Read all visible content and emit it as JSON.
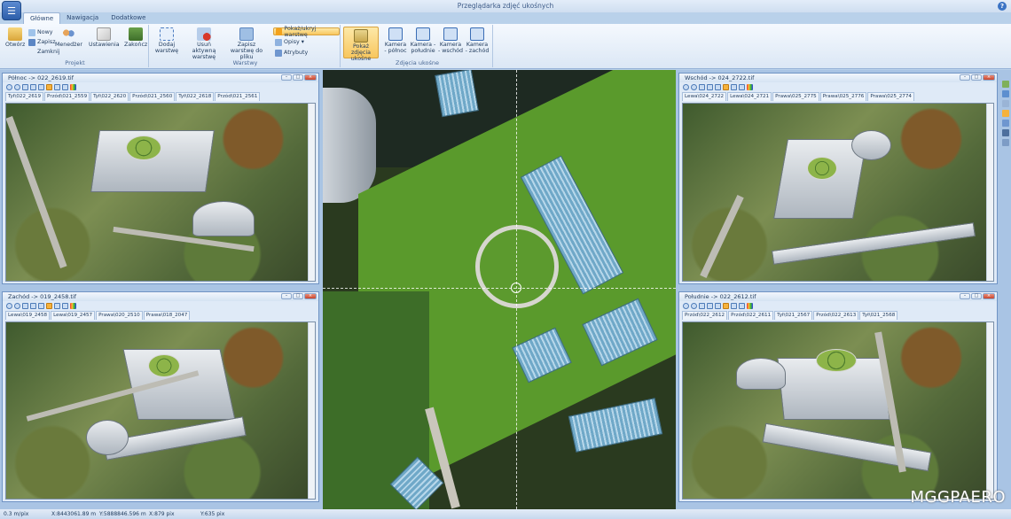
{
  "window": {
    "title": "Przeglądarka zdjęć ukośnych",
    "help": "?"
  },
  "tabs": [
    {
      "label": "Główne"
    },
    {
      "label": "Nawigacja"
    },
    {
      "label": "Dodatkowe"
    }
  ],
  "ribbon": {
    "projekt": {
      "label": "Projekt",
      "open": "Otwórz",
      "new": "Nowy",
      "save": "Zapisz",
      "close": "Zamknij",
      "manager": "Menedżer",
      "settings": "Ustawienia",
      "exit": "Zakończ"
    },
    "warstwy": {
      "label": "Warstwy",
      "add_layer": "Dodaj warstwę",
      "remove_layer": "Usuń aktywną warstwę",
      "save_layer": "Zapisz warstwę do pliku",
      "show_hide": "Pokaż/ukryj warstwę",
      "descriptions": "Opisy",
      "attributes": "Atrybuty"
    },
    "zdjecia": {
      "label": "Zdjęcia ukośne",
      "show_oblique": "Pokaż zdjęcia ukośne",
      "cam_north": "Kamera - północ",
      "cam_south": "Kamera - południe",
      "cam_east": "Kamera - wschód",
      "cam_west": "Kamera - zachód"
    }
  },
  "panels": {
    "north": {
      "title": "Północ -> 022_2619.tif",
      "tabs": [
        "Tył\\022_2619",
        "Przód\\021_2559",
        "Tył\\022_2620",
        "Przód\\021_2560",
        "Tył\\022_2618",
        "Przód\\021_2561"
      ]
    },
    "west": {
      "title": "Zachód -> 019_2458.tif",
      "tabs": [
        "Lewa\\019_2458",
        "Lewa\\019_2457",
        "Prawa\\020_2510",
        "Prawa\\018_2047"
      ]
    },
    "east": {
      "title": "Wschód -> 024_2722.tif",
      "tabs": [
        "Lewa\\024_2722",
        "Lewa\\024_2721",
        "Prawa\\025_2775",
        "Prawa\\025_2776",
        "Prawa\\025_2774"
      ]
    },
    "south": {
      "title": "Południe -> 022_2612.tif",
      "tabs": [
        "Przód\\022_2612",
        "Przód\\022_2611",
        "Tył\\021_2567",
        "Przód\\022_2613",
        "Tył\\021_2568"
      ]
    }
  },
  "status": {
    "scale": "0.3 m/pix",
    "x": "X:8443061.89 m",
    "y": "Y:5888846.596 m",
    "xpix": "X:879 pix",
    "ypix": "Y:635 pix"
  },
  "logo": "MGGPAERO",
  "colors": {
    "accent": "#f8c75e",
    "ribbon": "#dbe7f5",
    "frame": "#6f93c4"
  }
}
